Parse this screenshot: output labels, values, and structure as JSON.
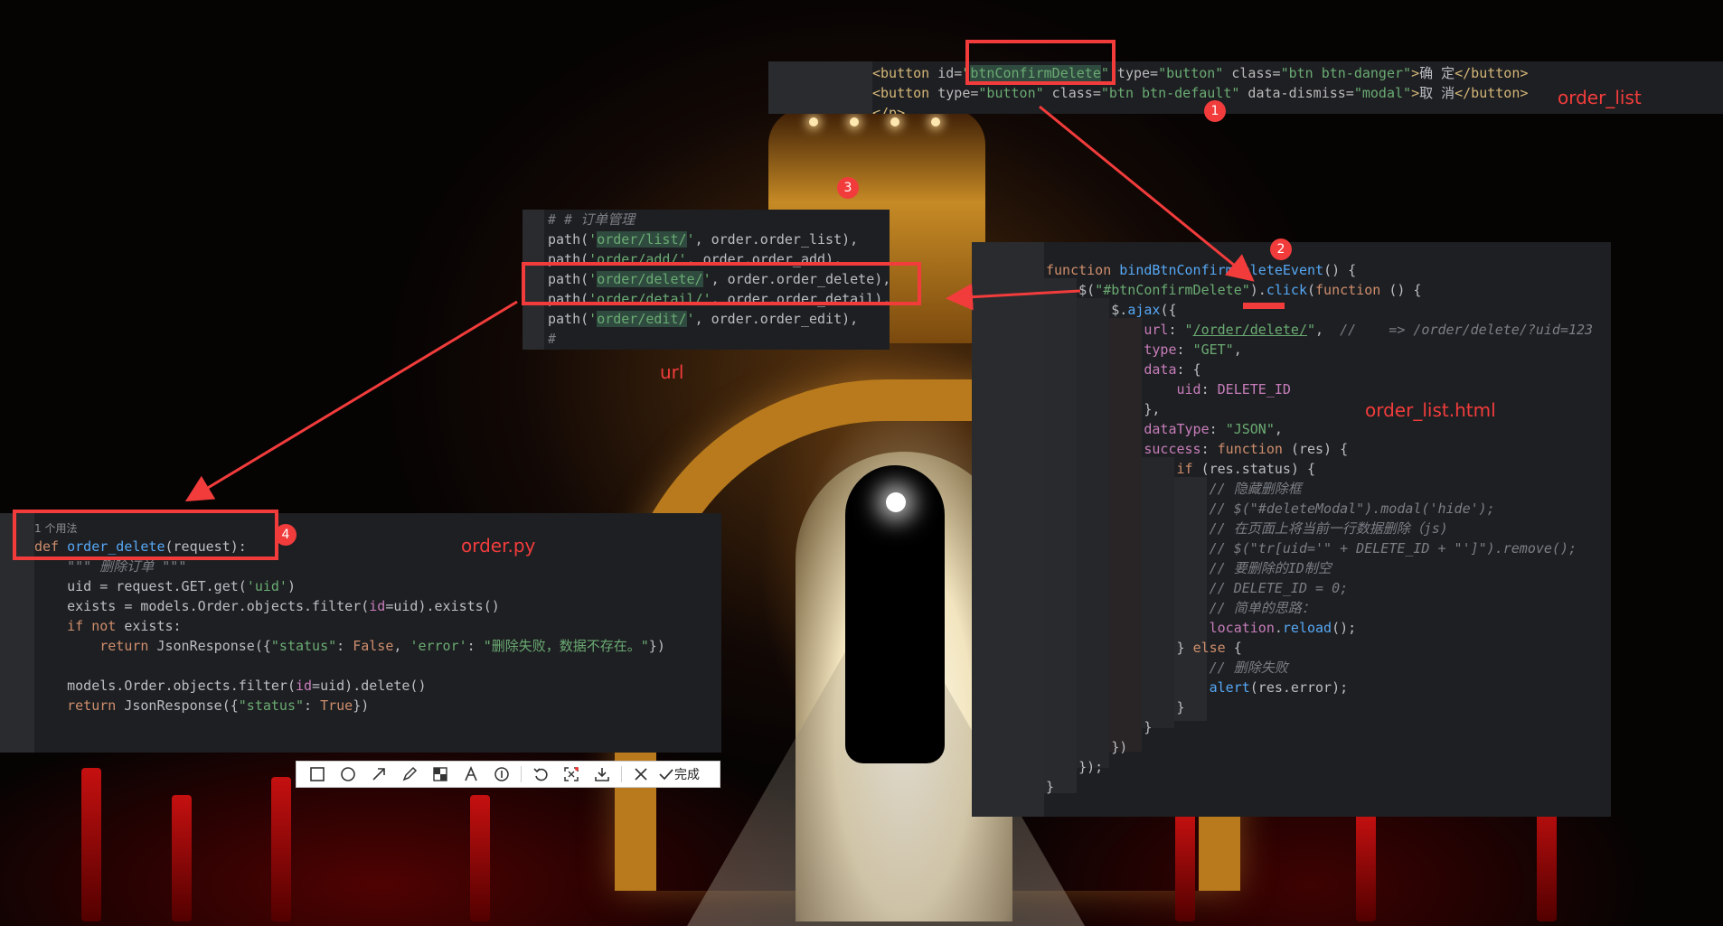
{
  "order_list_panel": {
    "lines": [
      [
        [
          "tag",
          "<button"
        ],
        [
          "attr",
          " id="
        ],
        [
          "str",
          "\""
        ],
        [
          "str hl",
          "btnConfirmDelete"
        ],
        [
          "str",
          "\""
        ],
        [
          "attr",
          " type="
        ],
        [
          "str",
          "\"button\""
        ],
        [
          "attr",
          " class="
        ],
        [
          "str",
          "\"btn btn-danger\""
        ],
        [
          "tag",
          ">"
        ],
        [
          "plain",
          "确 定"
        ],
        [
          "tag",
          "</button>"
        ]
      ],
      [
        [
          "tag",
          "<button"
        ],
        [
          "attr",
          " type="
        ],
        [
          "str",
          "\"button\""
        ],
        [
          "attr",
          " class="
        ],
        [
          "str",
          "\"btn btn-default\""
        ],
        [
          "attr",
          " data-dismiss="
        ],
        [
          "str",
          "\"modal\""
        ],
        [
          "tag",
          ">"
        ],
        [
          "plain",
          "取 消"
        ],
        [
          "tag",
          "</button>"
        ]
      ],
      [
        [
          "tag",
          "</p>"
        ]
      ]
    ],
    "label": "order_list"
  },
  "url_panel": {
    "lines": [
      [
        [
          "cm",
          "# # 订单管理"
        ]
      ],
      [
        [
          "plain",
          "path("
        ],
        [
          "str",
          "'"
        ],
        [
          "str hl",
          "order/list/"
        ],
        [
          "str",
          "'"
        ],
        [
          "plain",
          ", order.order_list),"
        ]
      ],
      [
        [
          "plain",
          "path("
        ],
        [
          "str",
          "'order/add/'"
        ],
        [
          "plain",
          ", order.order_add),"
        ]
      ],
      [
        [
          "plain",
          "path("
        ],
        [
          "str",
          "'"
        ],
        [
          "str hl",
          "order/delete/"
        ],
        [
          "str",
          "'"
        ],
        [
          "plain",
          ", order.order_delete),"
        ]
      ],
      [
        [
          "plain",
          "path("
        ],
        [
          "str",
          "'order/detail/'"
        ],
        [
          "plain",
          ", order.order_detail),"
        ]
      ],
      [
        [
          "plain",
          "path("
        ],
        [
          "str",
          "'"
        ],
        [
          "str hl",
          "order/edit/"
        ],
        [
          "str",
          "'"
        ],
        [
          "plain",
          ", order.order_edit),"
        ]
      ],
      [
        [
          "cm",
          "#"
        ]
      ]
    ],
    "label": "url"
  },
  "order_py_panel": {
    "usage_hint": "1 个用法",
    "lines": [
      [
        [
          "kw",
          "def "
        ],
        [
          "fn",
          "order_delete"
        ],
        [
          "plain",
          "(request):"
        ]
      ],
      [
        [
          "cm",
          "    \"\"\" 删除订单 \"\"\""
        ]
      ],
      [
        [
          "plain",
          "    uid = request.GET.get("
        ],
        [
          "str",
          "'uid'"
        ],
        [
          "plain",
          ")"
        ]
      ],
      [
        [
          "plain",
          "    exists = models.Order.objects.filter("
        ],
        [
          "prop",
          "id"
        ],
        [
          "plain",
          "=uid).exists()"
        ]
      ],
      [
        [
          "kw",
          "    if not "
        ],
        [
          "plain",
          "exists:"
        ]
      ],
      [
        [
          "kw",
          "        return "
        ],
        [
          "plain",
          "JsonResponse({"
        ],
        [
          "str",
          "\"status\""
        ],
        [
          "plain",
          ": "
        ],
        [
          "kw",
          "False"
        ],
        [
          "plain",
          ", "
        ],
        [
          "str",
          "'error'"
        ],
        [
          "plain",
          ": "
        ],
        [
          "str",
          "\"删除失败，数据不存在。\""
        ],
        [
          "plain",
          "})"
        ]
      ],
      [
        [
          "plain",
          ""
        ]
      ],
      [
        [
          "plain",
          "    models.Order.objects.filter("
        ],
        [
          "prop",
          "id"
        ],
        [
          "plain",
          "=uid).delete()"
        ]
      ],
      [
        [
          "kw",
          "    return "
        ],
        [
          "plain",
          "JsonResponse({"
        ],
        [
          "str",
          "\"status\""
        ],
        [
          "plain",
          ": "
        ],
        [
          "kw",
          "True"
        ],
        [
          "plain",
          "})"
        ]
      ]
    ],
    "label": "order.py"
  },
  "order_list_html_panel": {
    "lines": [
      [
        [
          "kw",
          "function "
        ],
        [
          "fn",
          "bindBtnConfirmDeleteEvent"
        ],
        [
          "plain",
          "() {"
        ]
      ],
      [
        [
          "plain",
          "    $("
        ],
        [
          "str",
          "\"#btnConfirmDelete\""
        ],
        [
          "plain",
          ")."
        ],
        [
          "fn",
          "click"
        ],
        [
          "plain",
          "("
        ],
        [
          "kw",
          "function "
        ],
        [
          "plain",
          "() {"
        ]
      ],
      [
        [
          "plain",
          "        $."
        ],
        [
          "fn",
          "ajax"
        ],
        [
          "plain",
          "({"
        ]
      ],
      [
        [
          "prop",
          "            url"
        ],
        [
          "plain",
          ": "
        ],
        [
          "str",
          "\""
        ],
        [
          "str link",
          "/order/delete/"
        ],
        [
          "str",
          "\""
        ],
        [
          "plain",
          ",  "
        ],
        [
          "cm",
          "//    => /order/delete/?uid=123"
        ]
      ],
      [
        [
          "prop",
          "            type"
        ],
        [
          "plain",
          ": "
        ],
        [
          "str",
          "\"GET\""
        ],
        [
          "plain",
          ","
        ]
      ],
      [
        [
          "prop",
          "            data"
        ],
        [
          "plain",
          ": {"
        ]
      ],
      [
        [
          "prop",
          "                uid"
        ],
        [
          "plain",
          ": "
        ],
        [
          "prop",
          "DELETE_ID"
        ]
      ],
      [
        [
          "plain",
          "            },"
        ]
      ],
      [
        [
          "prop",
          "            dataType"
        ],
        [
          "plain",
          ": "
        ],
        [
          "str",
          "\"JSON\""
        ],
        [
          "plain",
          ","
        ]
      ],
      [
        [
          "prop",
          "            success"
        ],
        [
          "plain",
          ": "
        ],
        [
          "kw",
          "function "
        ],
        [
          "plain",
          "(res) {"
        ]
      ],
      [
        [
          "kw",
          "                if "
        ],
        [
          "plain",
          "(res.status) {"
        ]
      ],
      [
        [
          "cm",
          "                    // 隐藏删除框"
        ]
      ],
      [
        [
          "cm",
          "                    // $(\"#deleteModal\").modal('hide');"
        ]
      ],
      [
        [
          "cm",
          "                    // 在页面上将当前一行数据删除（js)"
        ]
      ],
      [
        [
          "cm",
          "                    // $(\"tr[uid='\" + DELETE_ID + \"']\").remove();"
        ]
      ],
      [
        [
          "cm",
          "                    // 要删除的ID制空"
        ]
      ],
      [
        [
          "cm",
          "                    // DELETE_ID = 0;"
        ]
      ],
      [
        [
          "cm",
          "                    // 简单的思路："
        ]
      ],
      [
        [
          "prop",
          "                    location"
        ],
        [
          "plain",
          "."
        ],
        [
          "fn",
          "reload"
        ],
        [
          "plain",
          "();"
        ]
      ],
      [
        [
          "plain",
          "                } "
        ],
        [
          "kw",
          "else "
        ],
        [
          "plain",
          "{"
        ]
      ],
      [
        [
          "cm",
          "                    // 删除失败"
        ]
      ],
      [
        [
          "fn",
          "                    alert"
        ],
        [
          "plain",
          "(res.error);"
        ]
      ],
      [
        [
          "plain",
          "                }"
        ]
      ],
      [
        [
          "plain",
          "            }"
        ]
      ],
      [
        [
          "plain",
          "        })"
        ]
      ],
      [
        [
          "plain",
          "    });"
        ]
      ],
      [
        [
          "plain",
          "}"
        ]
      ]
    ],
    "label": "order_list.html"
  },
  "badges": [
    "1",
    "2",
    "3",
    "4"
  ],
  "toolbar": {
    "items": [
      "rectangle-icon",
      "ellipse-icon",
      "arrow-icon",
      "pencil-icon",
      "mosaic-icon",
      "text-icon",
      "numbered-marker-icon",
      "undo-icon",
      "ocr-icon",
      "save-icon",
      "close-icon"
    ],
    "done_label": "完成"
  },
  "colors": {
    "annotation": "#f23c3c",
    "editor_bg": "#1e1f22"
  }
}
